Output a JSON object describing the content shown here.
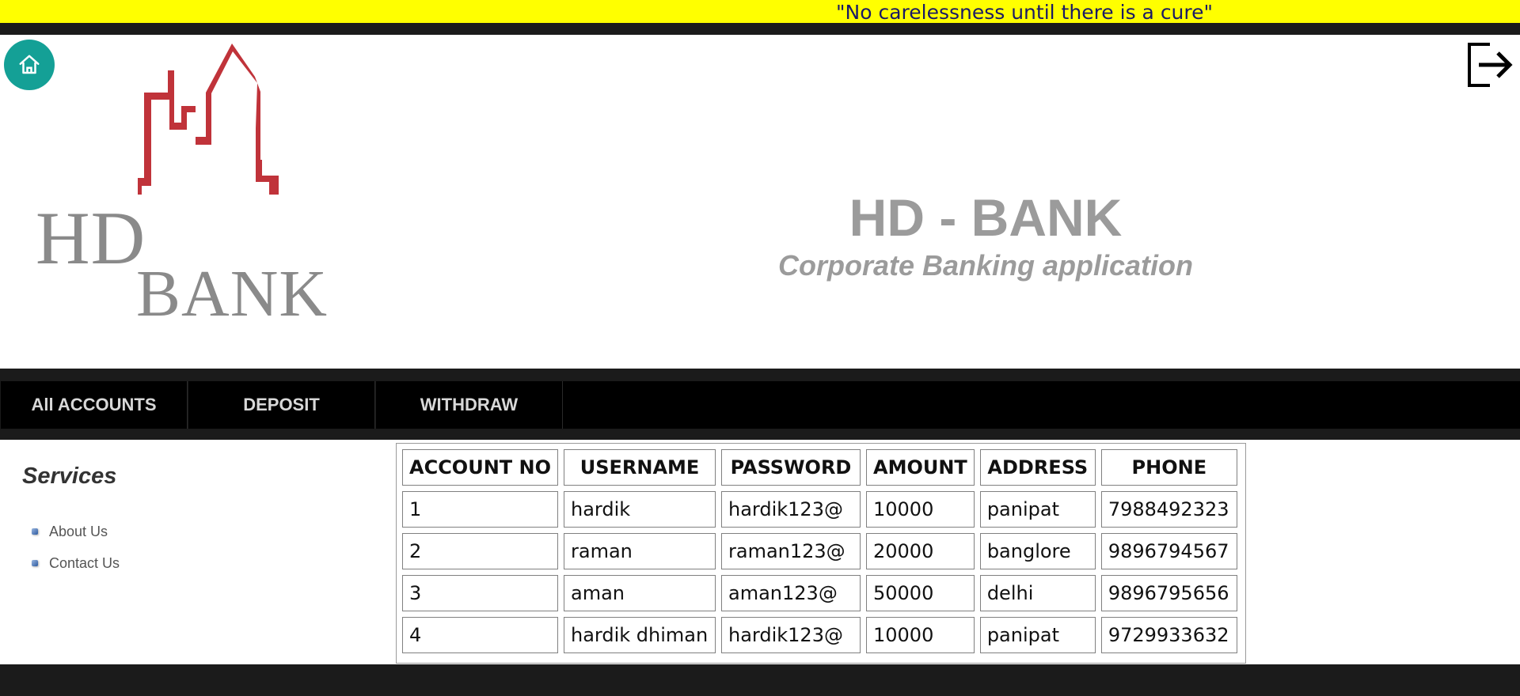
{
  "marquee": {
    "text": "\"No carelessness until there is a cure\""
  },
  "header": {
    "home_icon": "home-icon",
    "logout_icon": "logout-icon",
    "logo": {
      "line1": "HD",
      "line2": "BANK"
    },
    "title": "HD - BANK",
    "subtitle": "Corporate Banking application"
  },
  "nav": {
    "items": [
      {
        "label": "All ACCOUNTS"
      },
      {
        "label": "DEPOSIT"
      },
      {
        "label": "WITHDRAW"
      }
    ]
  },
  "sidebar": {
    "title": "Services",
    "items": [
      {
        "label": "About Us"
      },
      {
        "label": "Contact Us"
      }
    ]
  },
  "accounts_table": {
    "headers": [
      "ACCOUNT NO",
      "USERNAME",
      "PASSWORD",
      "AMOUNT",
      "ADDRESS",
      "PHONE"
    ],
    "rows": [
      [
        "1",
        "hardik",
        "hardik123@",
        "10000",
        "panipat",
        "7988492323"
      ],
      [
        "2",
        "raman",
        "raman123@",
        "20000",
        "banglore",
        "9896794567"
      ],
      [
        "3",
        "aman",
        "aman123@",
        "50000",
        "delhi",
        "9896795656"
      ],
      [
        "4",
        "hardik dhiman",
        "hardik123@",
        "10000",
        "panipat",
        "9729933632"
      ]
    ]
  },
  "colors": {
    "marquee_bg": "#ffff00",
    "home_button": "#14a096",
    "logo_red": "#c0333a",
    "nav_bg": "#000000"
  }
}
